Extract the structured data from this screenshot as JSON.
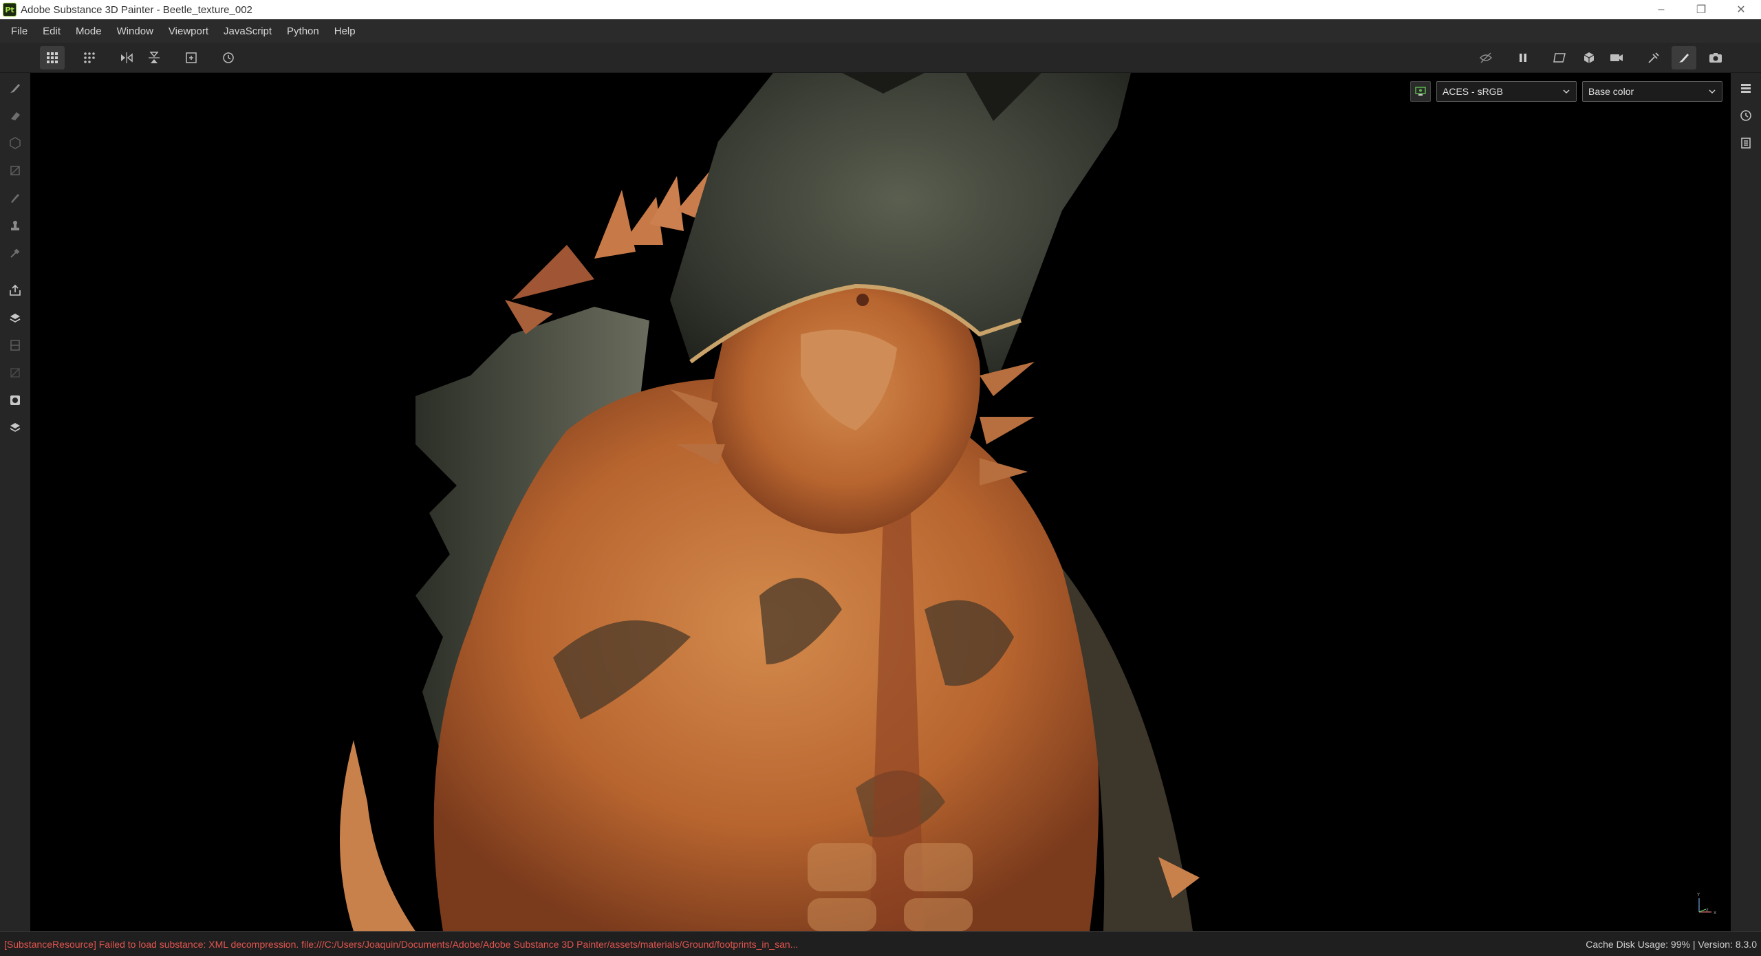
{
  "window": {
    "logo_text": "Pt",
    "title": "Adobe Substance 3D Painter - Beetle_texture_002",
    "minimize": "–",
    "maximize": "❐",
    "close": "✕"
  },
  "menu": {
    "items": [
      "File",
      "Edit",
      "Mode",
      "Window",
      "Viewport",
      "JavaScript",
      "Python",
      "Help"
    ]
  },
  "toolbar": {
    "left_icons": [
      "grid-view-icon",
      "grid-options-icon",
      "symmetry-icon",
      "symmetry-vertical-icon",
      "fit-frame-icon",
      "history-reset-icon"
    ],
    "right_icons": [
      "hide-icon",
      "pause-icon",
      "perspective-icon",
      "cube-icon",
      "camera-icon",
      "bake-icon",
      "paint-icon",
      "screenshot-icon"
    ]
  },
  "viewport": {
    "colorspace_value": "ACES - sRGB",
    "channel_value": "Base color",
    "axis_y": "Y",
    "axis_x": "x",
    "axis_z": "z"
  },
  "status": {
    "error_text": "[SubstanceResource] Failed to load substance: XML decompression. file:///C:/Users/Joaquin/Documents/Adobe/Adobe Substance 3D Painter/assets/materials/Ground/footprints_in_san...",
    "cache_text": "Cache Disk Usage:   99% | Version: 8.3.0"
  },
  "colors": {
    "error": "#e2554f",
    "creature_orange": "#c8743a",
    "creature_dark": "#3a3d35"
  }
}
